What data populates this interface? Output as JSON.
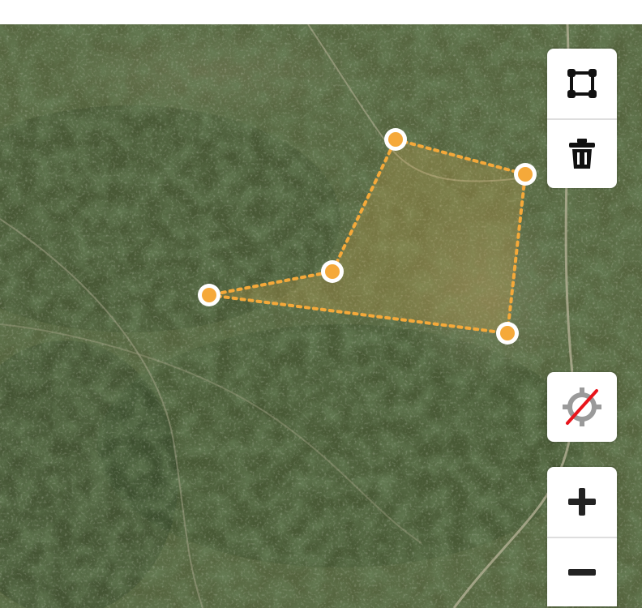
{
  "map": {
    "basemap": "satellite",
    "polygon": {
      "stroke_color": "#f5a93a",
      "fill_color": "#c9a14c",
      "vertex_color": "#f5a93a",
      "vertex_ring_color": "#ffffff",
      "vertex_count": 5
    }
  },
  "controls": {
    "draw_polygon": {
      "icon": "polygon-draw-icon"
    },
    "delete": {
      "icon": "trash-icon"
    },
    "geolocate": {
      "icon": "geolocate-disabled-icon",
      "state": "disabled",
      "slash_color": "#e8141b"
    },
    "zoom_in": {
      "icon": "plus-icon"
    },
    "zoom_out": {
      "icon": "minus-icon"
    }
  }
}
